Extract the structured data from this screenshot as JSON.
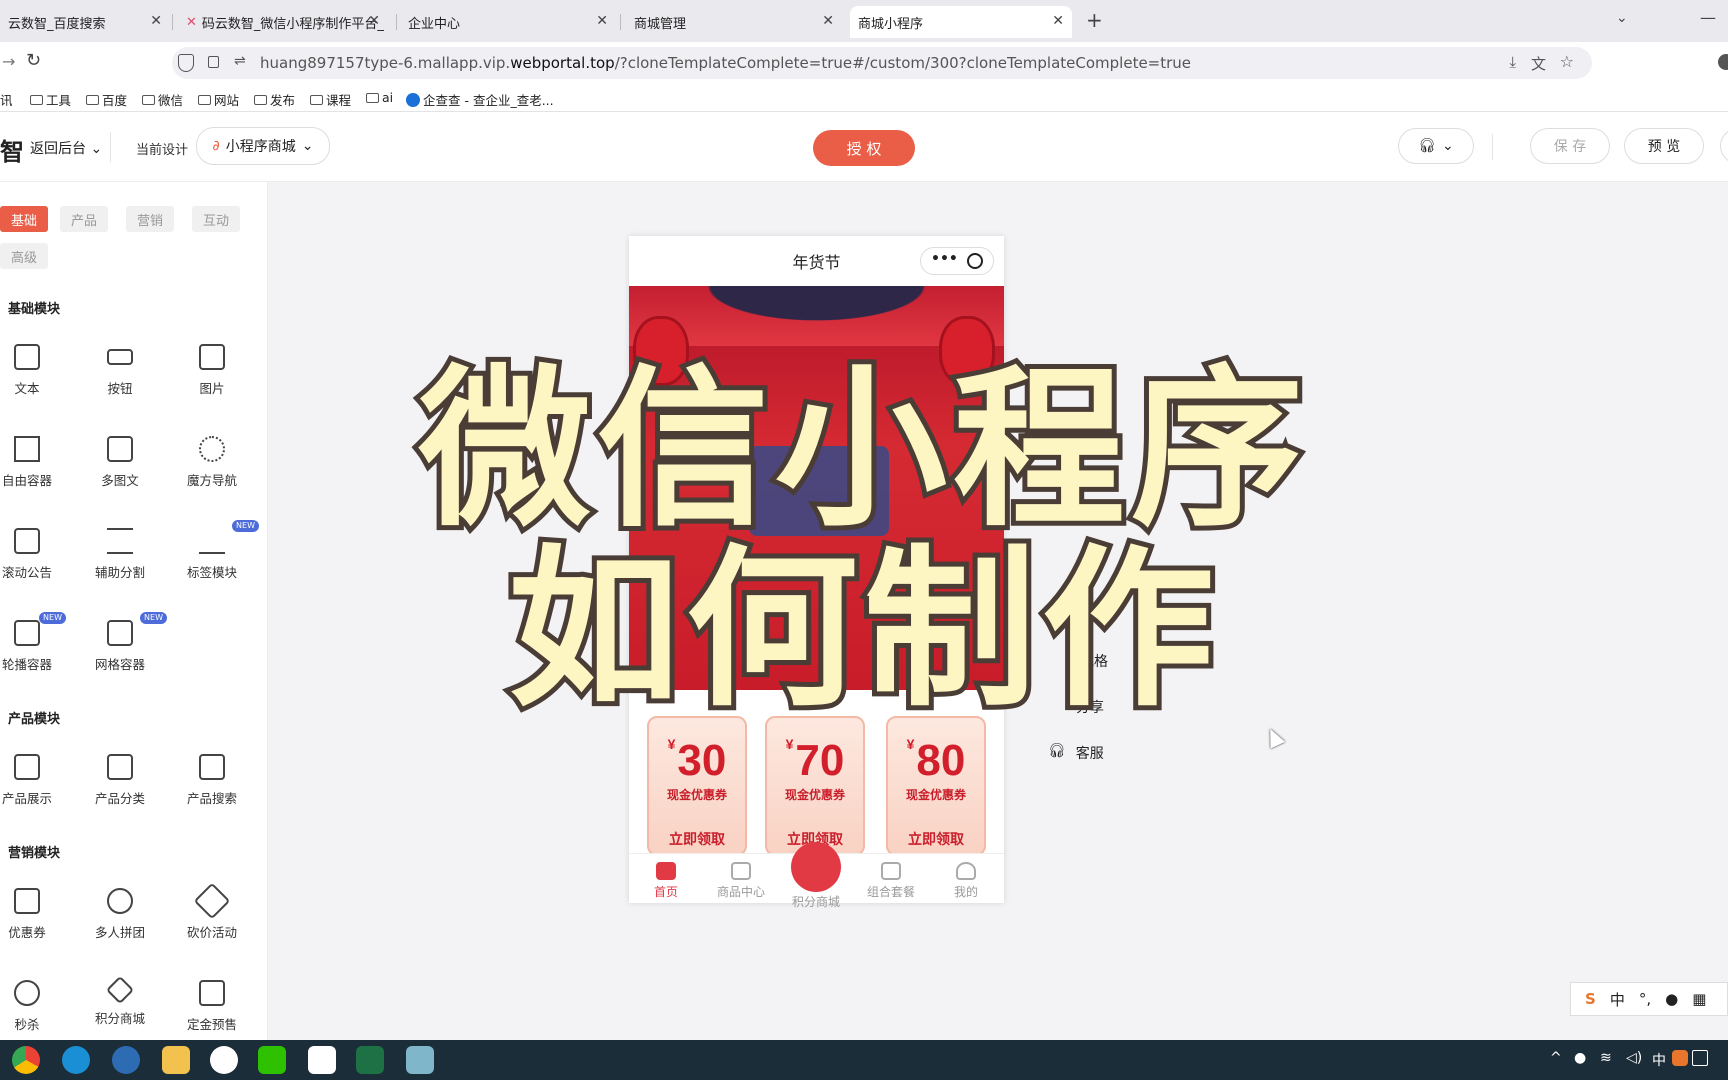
{
  "browser": {
    "tabs": [
      {
        "label": "云数智_百度搜索",
        "active": false
      },
      {
        "label": "码云数智_微信小程序制作平台_",
        "active": false
      },
      {
        "label": "企业中心",
        "active": false
      },
      {
        "label": "商城管理",
        "active": false
      },
      {
        "label": "商城小程序",
        "active": true
      }
    ],
    "url_prefix": "huang897157type-6.mallapp.vip.",
    "url_domain": "webportal.top",
    "url_suffix": "/?cloneTemplateComplete=true#/custom/300?cloneTemplateComplete=true",
    "bookmarks": [
      "讯",
      "工具",
      "百度",
      "微信",
      "网站",
      "发布",
      "课程",
      "ai",
      "企查查 - 查企业_查老..."
    ]
  },
  "header": {
    "logo_fragment": "智",
    "back_label": "返回后台",
    "current_design_label": "当前设计",
    "design_select": "小程序商城",
    "authorize_button": "授 权",
    "save_button": "保 存",
    "preview_button": "预 览"
  },
  "sidebar": {
    "category_tabs": [
      "基础",
      "产品",
      "营销",
      "互动",
      "高级"
    ],
    "sections": [
      {
        "title": "基础模块",
        "items": [
          {
            "label": "文本",
            "icon": "text-icon"
          },
          {
            "label": "按钮",
            "icon": "button-icon"
          },
          {
            "label": "图片",
            "icon": "image-icon"
          },
          {
            "label": "自由容器",
            "icon": "free-container-icon"
          },
          {
            "label": "多图文",
            "icon": "multi-image-text-icon"
          },
          {
            "label": "魔方导航",
            "icon": "cube-nav-icon"
          },
          {
            "label": "滚动公告",
            "icon": "scroll-notice-icon"
          },
          {
            "label": "辅助分割",
            "icon": "divider-icon"
          },
          {
            "label": "标签模块",
            "icon": "tag-module-icon",
            "badge": "NEW"
          },
          {
            "label": "轮播容器",
            "icon": "carousel-icon",
            "badge": "NEW"
          },
          {
            "label": "网格容器",
            "icon": "grid-container-icon",
            "badge": "NEW"
          }
        ]
      },
      {
        "title": "产品模块",
        "items": [
          {
            "label": "产品展示",
            "icon": "product-display-icon"
          },
          {
            "label": "产品分类",
            "icon": "product-category-icon"
          },
          {
            "label": "产品搜索",
            "icon": "product-search-icon"
          }
        ]
      },
      {
        "title": "营销模块",
        "items": [
          {
            "label": "优惠券",
            "icon": "coupon-icon"
          },
          {
            "label": "多人拼团",
            "icon": "group-buy-icon"
          },
          {
            "label": "砍价活动",
            "icon": "bargain-icon"
          },
          {
            "label": "秒杀",
            "icon": "flash-sale-icon"
          },
          {
            "label": "积分商城",
            "icon": "points-mall-icon"
          },
          {
            "label": "定金预售",
            "icon": "deposit-presale-icon"
          }
        ]
      }
    ]
  },
  "phone": {
    "title": "年货节",
    "coupons": [
      {
        "currency": "¥",
        "amount": "30",
        "label": "现金优惠券",
        "action": "立即领取"
      },
      {
        "currency": "¥",
        "amount": "70",
        "label": "现金优惠券",
        "action": "立即领取"
      },
      {
        "currency": "¥",
        "amount": "80",
        "label": "现金优惠券",
        "action": "立即领取"
      }
    ],
    "nav": [
      "首页",
      "商品中心",
      "积分商城",
      "组合套餐",
      "我的"
    ]
  },
  "right_panel": {
    "style_label": "风格",
    "share_label": "分享",
    "service_label": "客服"
  },
  "overlay": {
    "line1": "微信小程序",
    "line2": "如何制作"
  },
  "ime": {
    "mode": "中"
  },
  "colors": {
    "accent": "#ea5e47",
    "overlay_fill": "#fdf6c3",
    "overlay_stroke": "#4a3d36",
    "coupon_red": "#d21f2c"
  }
}
